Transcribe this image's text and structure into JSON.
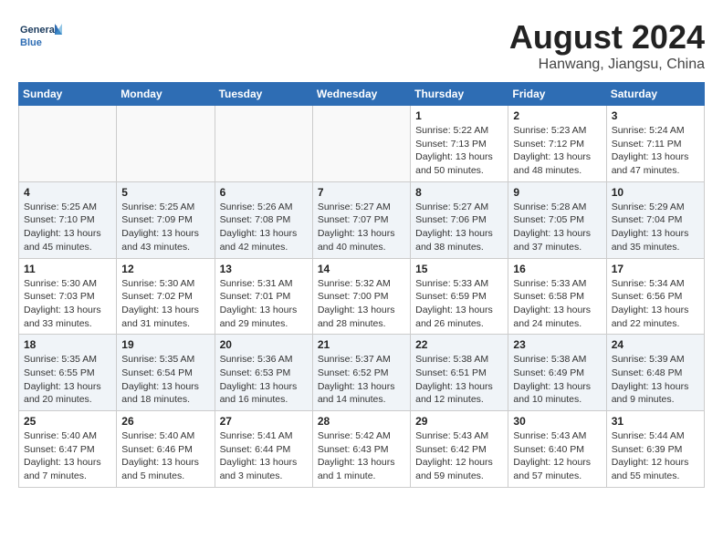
{
  "header": {
    "logo_line1": "General",
    "logo_line2": "Blue",
    "month_year": "August 2024",
    "location": "Hanwang, Jiangsu, China"
  },
  "weekdays": [
    "Sunday",
    "Monday",
    "Tuesday",
    "Wednesday",
    "Thursday",
    "Friday",
    "Saturday"
  ],
  "weeks": [
    [
      {
        "day": "",
        "info": ""
      },
      {
        "day": "",
        "info": ""
      },
      {
        "day": "",
        "info": ""
      },
      {
        "day": "",
        "info": ""
      },
      {
        "day": "1",
        "info": "Sunrise: 5:22 AM\nSunset: 7:13 PM\nDaylight: 13 hours\nand 50 minutes."
      },
      {
        "day": "2",
        "info": "Sunrise: 5:23 AM\nSunset: 7:12 PM\nDaylight: 13 hours\nand 48 minutes."
      },
      {
        "day": "3",
        "info": "Sunrise: 5:24 AM\nSunset: 7:11 PM\nDaylight: 13 hours\nand 47 minutes."
      }
    ],
    [
      {
        "day": "4",
        "info": "Sunrise: 5:25 AM\nSunset: 7:10 PM\nDaylight: 13 hours\nand 45 minutes."
      },
      {
        "day": "5",
        "info": "Sunrise: 5:25 AM\nSunset: 7:09 PM\nDaylight: 13 hours\nand 43 minutes."
      },
      {
        "day": "6",
        "info": "Sunrise: 5:26 AM\nSunset: 7:08 PM\nDaylight: 13 hours\nand 42 minutes."
      },
      {
        "day": "7",
        "info": "Sunrise: 5:27 AM\nSunset: 7:07 PM\nDaylight: 13 hours\nand 40 minutes."
      },
      {
        "day": "8",
        "info": "Sunrise: 5:27 AM\nSunset: 7:06 PM\nDaylight: 13 hours\nand 38 minutes."
      },
      {
        "day": "9",
        "info": "Sunrise: 5:28 AM\nSunset: 7:05 PM\nDaylight: 13 hours\nand 37 minutes."
      },
      {
        "day": "10",
        "info": "Sunrise: 5:29 AM\nSunset: 7:04 PM\nDaylight: 13 hours\nand 35 minutes."
      }
    ],
    [
      {
        "day": "11",
        "info": "Sunrise: 5:30 AM\nSunset: 7:03 PM\nDaylight: 13 hours\nand 33 minutes."
      },
      {
        "day": "12",
        "info": "Sunrise: 5:30 AM\nSunset: 7:02 PM\nDaylight: 13 hours\nand 31 minutes."
      },
      {
        "day": "13",
        "info": "Sunrise: 5:31 AM\nSunset: 7:01 PM\nDaylight: 13 hours\nand 29 minutes."
      },
      {
        "day": "14",
        "info": "Sunrise: 5:32 AM\nSunset: 7:00 PM\nDaylight: 13 hours\nand 28 minutes."
      },
      {
        "day": "15",
        "info": "Sunrise: 5:33 AM\nSunset: 6:59 PM\nDaylight: 13 hours\nand 26 minutes."
      },
      {
        "day": "16",
        "info": "Sunrise: 5:33 AM\nSunset: 6:58 PM\nDaylight: 13 hours\nand 24 minutes."
      },
      {
        "day": "17",
        "info": "Sunrise: 5:34 AM\nSunset: 6:56 PM\nDaylight: 13 hours\nand 22 minutes."
      }
    ],
    [
      {
        "day": "18",
        "info": "Sunrise: 5:35 AM\nSunset: 6:55 PM\nDaylight: 13 hours\nand 20 minutes."
      },
      {
        "day": "19",
        "info": "Sunrise: 5:35 AM\nSunset: 6:54 PM\nDaylight: 13 hours\nand 18 minutes."
      },
      {
        "day": "20",
        "info": "Sunrise: 5:36 AM\nSunset: 6:53 PM\nDaylight: 13 hours\nand 16 minutes."
      },
      {
        "day": "21",
        "info": "Sunrise: 5:37 AM\nSunset: 6:52 PM\nDaylight: 13 hours\nand 14 minutes."
      },
      {
        "day": "22",
        "info": "Sunrise: 5:38 AM\nSunset: 6:51 PM\nDaylight: 13 hours\nand 12 minutes."
      },
      {
        "day": "23",
        "info": "Sunrise: 5:38 AM\nSunset: 6:49 PM\nDaylight: 13 hours\nand 10 minutes."
      },
      {
        "day": "24",
        "info": "Sunrise: 5:39 AM\nSunset: 6:48 PM\nDaylight: 13 hours\nand 9 minutes."
      }
    ],
    [
      {
        "day": "25",
        "info": "Sunrise: 5:40 AM\nSunset: 6:47 PM\nDaylight: 13 hours\nand 7 minutes."
      },
      {
        "day": "26",
        "info": "Sunrise: 5:40 AM\nSunset: 6:46 PM\nDaylight: 13 hours\nand 5 minutes."
      },
      {
        "day": "27",
        "info": "Sunrise: 5:41 AM\nSunset: 6:44 PM\nDaylight: 13 hours\nand 3 minutes."
      },
      {
        "day": "28",
        "info": "Sunrise: 5:42 AM\nSunset: 6:43 PM\nDaylight: 13 hours\nand 1 minute."
      },
      {
        "day": "29",
        "info": "Sunrise: 5:43 AM\nSunset: 6:42 PM\nDaylight: 12 hours\nand 59 minutes."
      },
      {
        "day": "30",
        "info": "Sunrise: 5:43 AM\nSunset: 6:40 PM\nDaylight: 12 hours\nand 57 minutes."
      },
      {
        "day": "31",
        "info": "Sunrise: 5:44 AM\nSunset: 6:39 PM\nDaylight: 12 hours\nand 55 minutes."
      }
    ]
  ]
}
